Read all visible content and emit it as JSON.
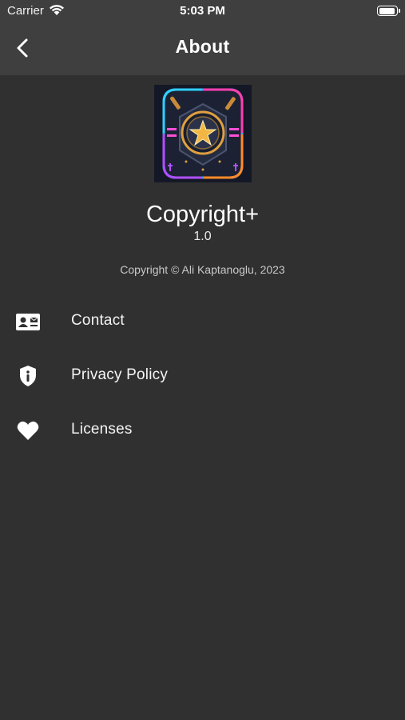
{
  "status_bar": {
    "carrier": "Carrier",
    "time": "5:03 PM"
  },
  "nav": {
    "title": "About",
    "back_icon": "chevron-left-icon"
  },
  "app": {
    "name": "Copyright+",
    "version": "1.0",
    "copyright": "Copyright © Ali Kaptanoglu, 2023"
  },
  "menu": [
    {
      "label": "Contact",
      "icon": "contact-card-icon"
    },
    {
      "label": "Privacy Policy",
      "icon": "shield-info-icon"
    },
    {
      "label": "Licenses",
      "icon": "heart-icon"
    }
  ],
  "colors": {
    "background": "#303030",
    "app_bar": "#3f3f3f",
    "text": "#ffffff",
    "secondary_text": "#c9c9c9"
  }
}
